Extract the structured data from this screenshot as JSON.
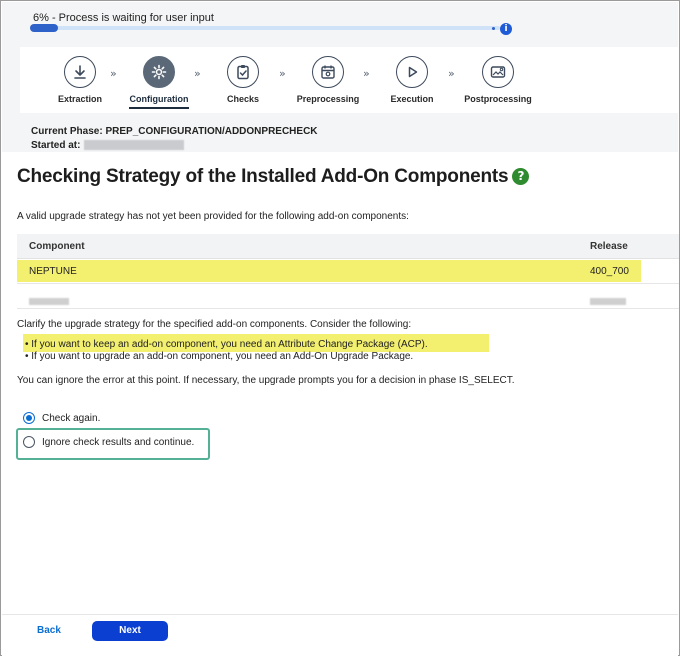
{
  "progress": {
    "label": "6% - Process is waiting for user input",
    "percent": 6,
    "info_icon": "i"
  },
  "steps": [
    {
      "label": "Extraction",
      "icon": "download-icon",
      "active": false
    },
    {
      "label": "Configuration",
      "icon": "gear-icon",
      "active": true
    },
    {
      "label": "Checks",
      "icon": "clipboard-check-icon",
      "active": false
    },
    {
      "label": "Preprocessing",
      "icon": "calendar-gear-icon",
      "active": false
    },
    {
      "label": "Execution",
      "icon": "play-icon",
      "active": false
    },
    {
      "label": "Postprocessing",
      "icon": "image-gear-icon",
      "active": false
    }
  ],
  "chevron": "»",
  "phase": {
    "current_label": "Current Phase: PREP_CONFIGURATION/ADDONPRECHECK",
    "started_label": "Started at:"
  },
  "page": {
    "title": "Checking Strategy of the Installed Add-On Components",
    "help_icon": "?",
    "intro": "A valid upgrade strategy has not yet been provided for the following add-on components:"
  },
  "table": {
    "headers": {
      "component": "Component",
      "release": "Release"
    },
    "rows": [
      {
        "component": "NEPTUNE",
        "release": "400_700",
        "highlighted": true
      }
    ]
  },
  "guidance": {
    "clarify": "Clarify the upgrade strategy for the specified add-on components. Consider the following:",
    "bullets": [
      "If you want to keep an add-on component, you need an Attribute Change Package (ACP).",
      "If you want to upgrade an add-on component, you need an Add-On Upgrade Package."
    ],
    "ignore_note": "You can ignore the error at this point. If necessary, the upgrade prompts you for a decision in phase IS_SELECT."
  },
  "options": {
    "check_again": "Check again.",
    "ignore_continue": "Ignore check results and continue.",
    "selected": "check_again"
  },
  "footer": {
    "back": "Back",
    "next": "Next"
  },
  "colors": {
    "accent": "#0a6ed1",
    "next_button": "#0a3fd1",
    "highlight": "#f3ef6f",
    "help_green": "#2f8b2f",
    "callout_border": "#55b196"
  }
}
